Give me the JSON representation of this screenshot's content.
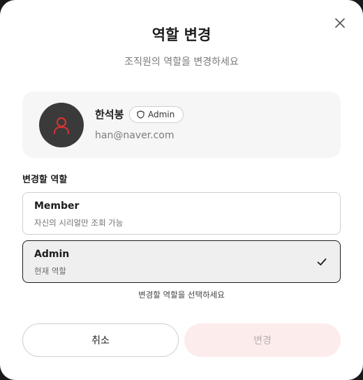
{
  "dialog": {
    "title": "역할 변경",
    "subtitle": "조직원의 역할을 변경하세요"
  },
  "user": {
    "name": "한석봉",
    "role_badge": "Admin",
    "email": "han@naver.com",
    "avatar_icon": "user-icon",
    "avatar_bg": "#3a3a3a",
    "avatar_icon_color": "#e0322f"
  },
  "role_section": {
    "label": "변경할 역할",
    "options": [
      {
        "name": "Member",
        "description": "자신의 시리얼만 조회 가능",
        "selected": false
      },
      {
        "name": "Admin",
        "description": "현재 역할",
        "selected": true
      }
    ],
    "hint": "변경할 역할을 선택하세요"
  },
  "actions": {
    "cancel_label": "취소",
    "confirm_label": "변경",
    "confirm_bg": "#fdecec"
  }
}
